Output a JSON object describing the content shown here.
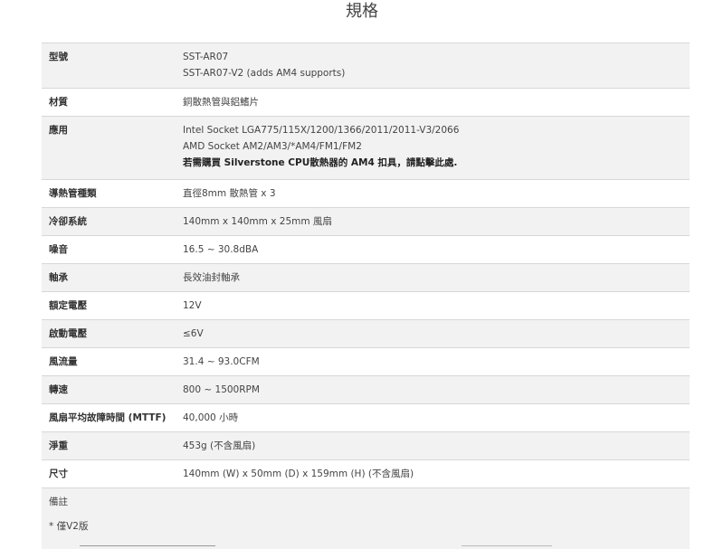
{
  "page": {
    "title": "規格"
  },
  "specs": [
    {
      "label": "型號",
      "lines": [
        {
          "text": "SST-AR07",
          "bold": false
        },
        {
          "text": "SST-AR07-V2 (adds AM4 supports)",
          "bold": false
        }
      ]
    },
    {
      "label": "材質",
      "lines": [
        {
          "text": "銅散熱管與鋁鰭片",
          "bold": false
        }
      ]
    },
    {
      "label": "應用",
      "lines": [
        {
          "text": "Intel Socket LGA775/115X/1200/1366/2011/2011-V3/2066",
          "bold": false
        },
        {
          "text": "AMD Socket AM2/AM3/*AM4/FM1/FM2",
          "bold": false
        },
        {
          "text": "若需購買 Silverstone CPU散熱器的 AM4 扣具，請點擊此處.",
          "bold": true
        }
      ]
    },
    {
      "label": "導熱管種類",
      "lines": [
        {
          "text": "直徑8mm 散熱管 x 3",
          "bold": false
        }
      ]
    },
    {
      "label": "冷卻系統",
      "lines": [
        {
          "text": "140mm x 140mm x 25mm 風扇",
          "bold": false
        }
      ]
    },
    {
      "label": "噪音",
      "lines": [
        {
          "text": "16.5 ~ 30.8dBA",
          "bold": false
        }
      ]
    },
    {
      "label": "軸承",
      "lines": [
        {
          "text": "長效油封軸承",
          "bold": false
        }
      ]
    },
    {
      "label": "額定電壓",
      "lines": [
        {
          "text": "12V",
          "bold": false
        }
      ]
    },
    {
      "label": "啟動電壓",
      "lines": [
        {
          "text": "≤6V",
          "bold": false
        }
      ]
    },
    {
      "label": "風流量",
      "lines": [
        {
          "text": "31.4 ~ 93.0CFM",
          "bold": false
        }
      ]
    },
    {
      "label": "轉速",
      "lines": [
        {
          "text": "800 ~ 1500RPM",
          "bold": false
        }
      ]
    },
    {
      "label": "風扇平均故障時間 (MTTF)",
      "lines": [
        {
          "text": "40,000 小時",
          "bold": false
        }
      ]
    },
    {
      "label": "淨重",
      "lines": [
        {
          "text": "453g (不含風扇)",
          "bold": false
        }
      ]
    },
    {
      "label": "尺寸",
      "lines": [
        {
          "text": "140mm (W) x 50mm (D) x 159mm (H) (不含風扇)",
          "bold": false
        }
      ]
    }
  ],
  "notes": {
    "title": "備註",
    "item": "* 僅V2版"
  }
}
